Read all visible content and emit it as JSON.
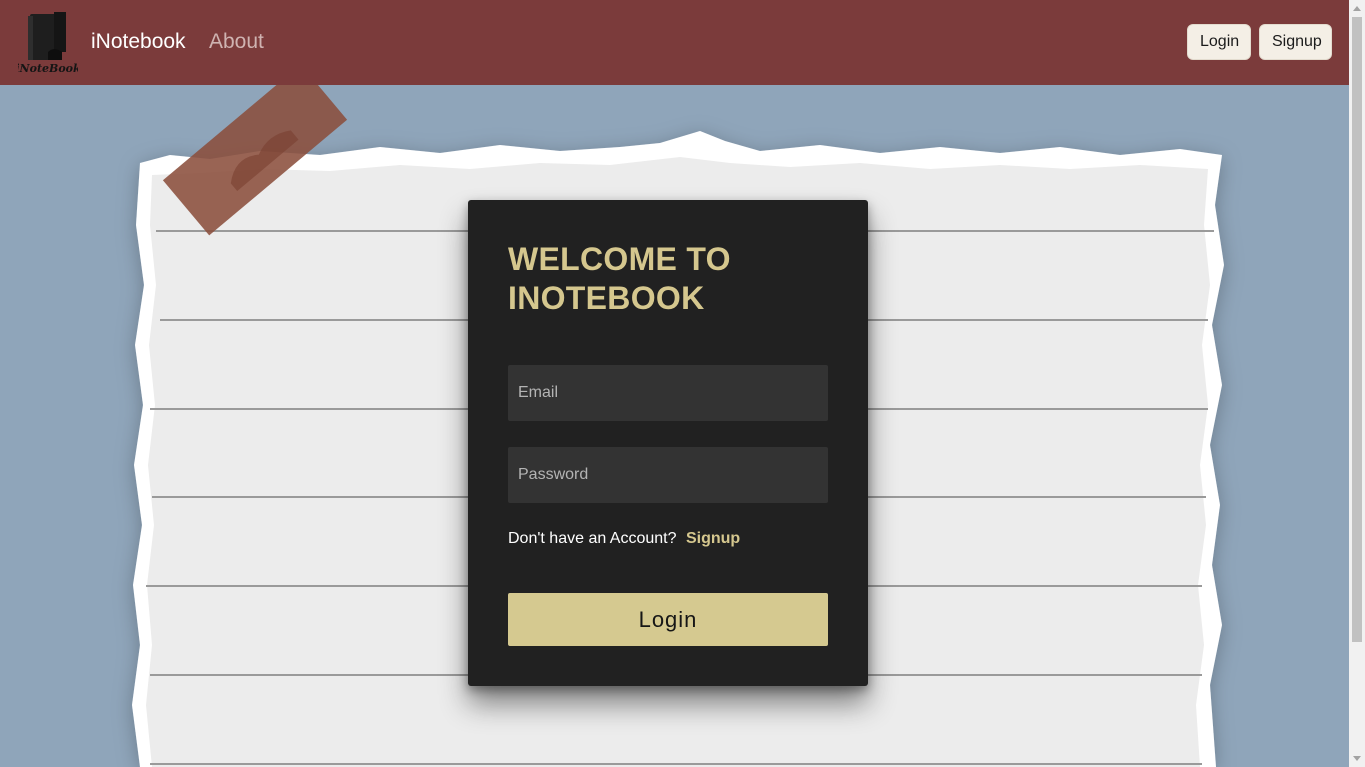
{
  "navbar": {
    "logo_text": "iNoteBook",
    "brand": "iNotebook",
    "about": "About",
    "login_button": "Login",
    "signup_button": "Signup"
  },
  "card": {
    "title_line1": "WELCOME TO",
    "title_line2": "INOTEBOOK",
    "email_placeholder": "Email",
    "password_placeholder": "Password",
    "account_prompt": "Don't have an Account?",
    "signup_link": "Signup",
    "login_button": "Login"
  },
  "colors": {
    "navbar": "#7b3b3b",
    "page_background": "#8fa5ba",
    "card": "#212121",
    "accent_gold": "#d5c78e",
    "paper": "#ececec",
    "tape": "#8b4e3c"
  }
}
